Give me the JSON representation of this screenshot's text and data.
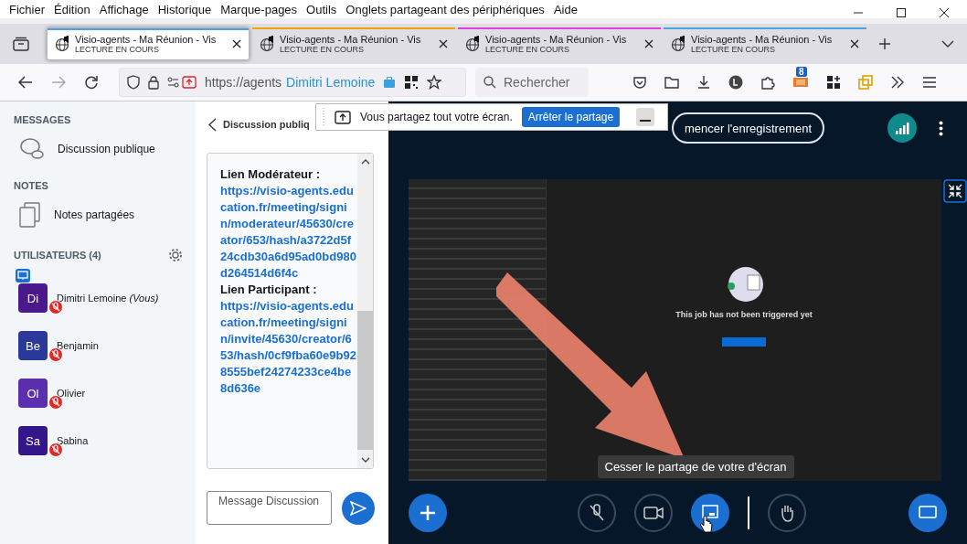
{
  "menu": [
    "Fichier",
    "Édition",
    "Affichage",
    "Historique",
    "Marque-pages",
    "Outils",
    "Onglets partageant des périphériques",
    "Aide"
  ],
  "tabs": [
    {
      "title": "Visio-agents - Ma Réunion - Vis",
      "status": "LECTURE EN COURS",
      "color": "#4aa3df",
      "selected": true
    },
    {
      "title": "Visio-agents - Ma Réunion - Vis",
      "status": "LECTURE EN COURS",
      "color": "#f0a30a",
      "selected": false
    },
    {
      "title": "Visio-agents - Ma Réunion - Vis",
      "status": "LECTURE EN COURS",
      "color": "#e040e0",
      "selected": false
    },
    {
      "title": "Visio-agents - Ma Réunion - Vis",
      "status": "LECTURE EN COURS",
      "color": "#4aa3df",
      "selected": false
    }
  ],
  "address": {
    "url": "https://agents",
    "overlay": "Dimitri Lemoine"
  },
  "search": {
    "placeholder": "Rechercher"
  },
  "extension_badge": "8",
  "sidebar": {
    "messages_heading": "MESSAGES",
    "messages": [
      {
        "label": "Discussion publique"
      }
    ],
    "notes_heading": "NOTES",
    "notes": [
      {
        "label": "Notes partagées"
      }
    ],
    "users_heading": "UTILISATEURS (4)",
    "users": [
      {
        "initials": "Di",
        "name": "Dimitri Lemoine *(Vous)*",
        "color": "#4a1a8c",
        "presenter": true,
        "muted": true
      },
      {
        "initials": "Be",
        "name": "Benjamin",
        "color": "#2b3a9a",
        "presenter": false,
        "muted": true
      },
      {
        "initials": "Ol",
        "name": "Olivier",
        "color": "#5b2fae",
        "presenter": false,
        "muted": true
      },
      {
        "initials": "Sa",
        "name": "Sabina",
        "color": "#33168a",
        "presenter": false,
        "muted": true
      }
    ]
  },
  "chat": {
    "title": "Discussion publiq",
    "message": [
      {
        "kind": "label",
        "text": "Lien Modérateur :"
      },
      {
        "kind": "link",
        "text": "https://visio-agents.education.fr/meeting/signin/moderateur/45630/creator/653/hash/a3722d5f24cdb30a6d95ad0bd980d264514d6f4c"
      },
      {
        "kind": "label",
        "text": "Lien Participant :"
      },
      {
        "kind": "link",
        "text": "https://visio-agents.education.fr/meeting/signin/invite/45630/creator/653/hash/0cf9fba60e9b928555bef24274233ce4be8d636e"
      }
    ],
    "input_placeholder": "Message Discussion"
  },
  "share_notice": {
    "text": "Vous partagez tout votre écran.",
    "button": "Arrêter le partage"
  },
  "meeting": {
    "record": "mencer l'enregistrement",
    "shared_screen": {
      "message": "This job has not been triggered yet"
    },
    "tooltip": "Cesser le partage de votre d'écran",
    "controls": [
      {
        "kind": "mic",
        "on": false
      },
      {
        "kind": "camera",
        "on": false
      },
      {
        "kind": "screen",
        "on": true
      },
      {
        "kind": "hand",
        "on": false
      }
    ]
  }
}
